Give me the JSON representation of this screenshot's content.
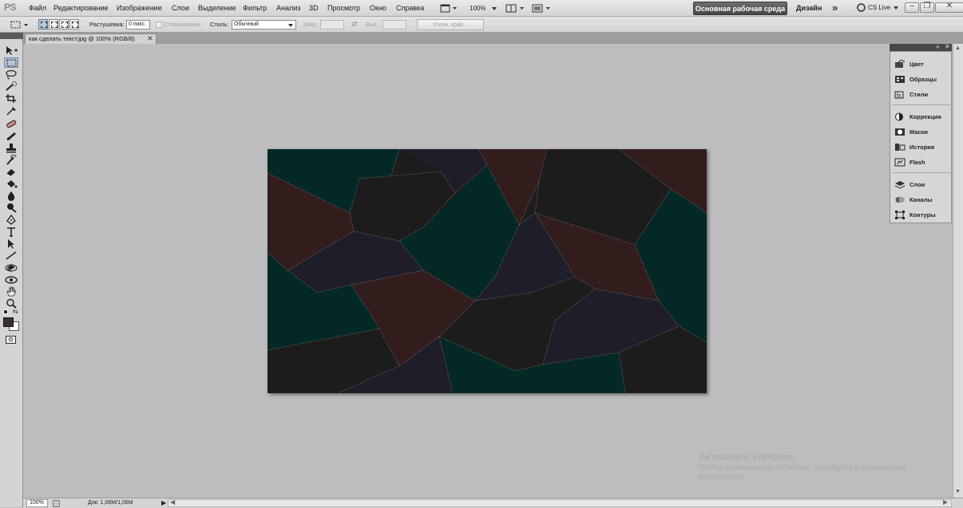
{
  "app": {
    "logo": "PS"
  },
  "menu": [
    "Файл",
    "Редактирование",
    "Изображение",
    "Слои",
    "Выделение",
    "Фильтр",
    "Анализ",
    "3D",
    "Просмотр",
    "Окно",
    "Справка"
  ],
  "menubar_controls": {
    "zoom_value": "100%",
    "workspace_label": "Основная рабочая среда",
    "design_label": "Дизайн",
    "more_glyph": "»",
    "cslive_label": "CS Live"
  },
  "options": {
    "feather_label": "Растушевка:",
    "feather_value": "0 пикс.",
    "antialias_label": "Сглаживание",
    "style_label": "Стиль:",
    "style_value": "Обычный",
    "width_label": "Шир.:",
    "height_label": "Выс.:",
    "refine_edge_label": "Уточн. край..."
  },
  "document": {
    "tab_title": "как сделать текст.jpg @ 100% (RGB/8)"
  },
  "tools": [
    "move-tool",
    "rectangular-marquee-tool",
    "lasso-tool",
    "quick-selection-tool",
    "crop-tool",
    "eyedropper-tool",
    "spot-healing-brush-tool",
    "brush-tool",
    "clone-stamp-tool",
    "history-brush-tool",
    "eraser-tool",
    "paint-bucket-tool",
    "blur-tool",
    "dodge-tool",
    "pen-tool",
    "type-tool",
    "path-selection-tool",
    "line-tool",
    "3d-rotate-tool",
    "3d-orbit-tool",
    "hand-tool",
    "zoom-tool"
  ],
  "colors": {
    "foreground": "#393030",
    "background": "#ffffff",
    "accent_active_tool": "#b6c4d6"
  },
  "panels": {
    "group1": [
      {
        "label": "Цвет",
        "icon": "color-icon"
      },
      {
        "label": "Образцы",
        "icon": "swatches-icon"
      },
      {
        "label": "Стили",
        "icon": "styles-icon"
      }
    ],
    "group2": [
      {
        "label": "Коррекция",
        "icon": "adjustments-icon"
      },
      {
        "label": "Маски",
        "icon": "masks-icon"
      },
      {
        "label": "История",
        "icon": "history-icon"
      },
      {
        "label": "Flash",
        "icon": "flash-icon"
      }
    ],
    "group3": [
      {
        "label": "Слои",
        "icon": "layers-icon"
      },
      {
        "label": "Каналы",
        "icon": "channels-icon"
      },
      {
        "label": "Контуры",
        "icon": "paths-icon"
      }
    ]
  },
  "status": {
    "zoom": "100%",
    "doc_size": "Док: 1,06M/1,06M"
  },
  "watermark": {
    "title": "Активация Windows",
    "text": "Чтобы активировать Windows, перейдите к параметрам компьютера."
  }
}
